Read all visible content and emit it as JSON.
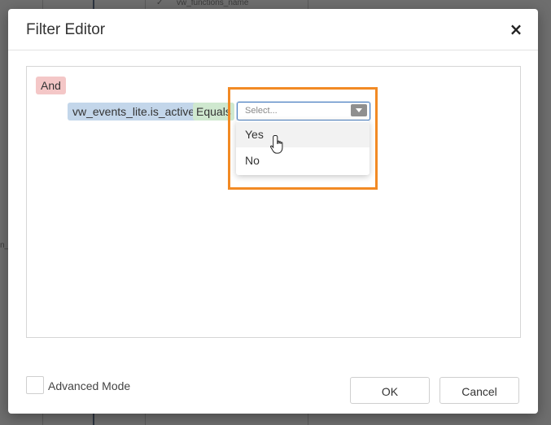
{
  "background": {
    "visible_text": "vw_functions_name",
    "left_text": "n_"
  },
  "dialog": {
    "title": "Filter Editor",
    "close_label": "×"
  },
  "filter": {
    "group_operator": "And",
    "field": "vw_events_lite.is_active",
    "operator": "Equals",
    "value_placeholder": "Select...",
    "options": [
      "Yes",
      "No"
    ],
    "hovered_option": "Yes"
  },
  "footer": {
    "advanced_mode_label": "Advanced Mode",
    "advanced_mode_checked": false,
    "ok_label": "OK",
    "cancel_label": "Cancel"
  },
  "colors": {
    "highlight": "#f28a24",
    "and_chip": "#f4c7c7",
    "field_chip": "#c3d6ea",
    "operator_chip": "#cfe8cf",
    "select_border": "#4a7fc1"
  }
}
